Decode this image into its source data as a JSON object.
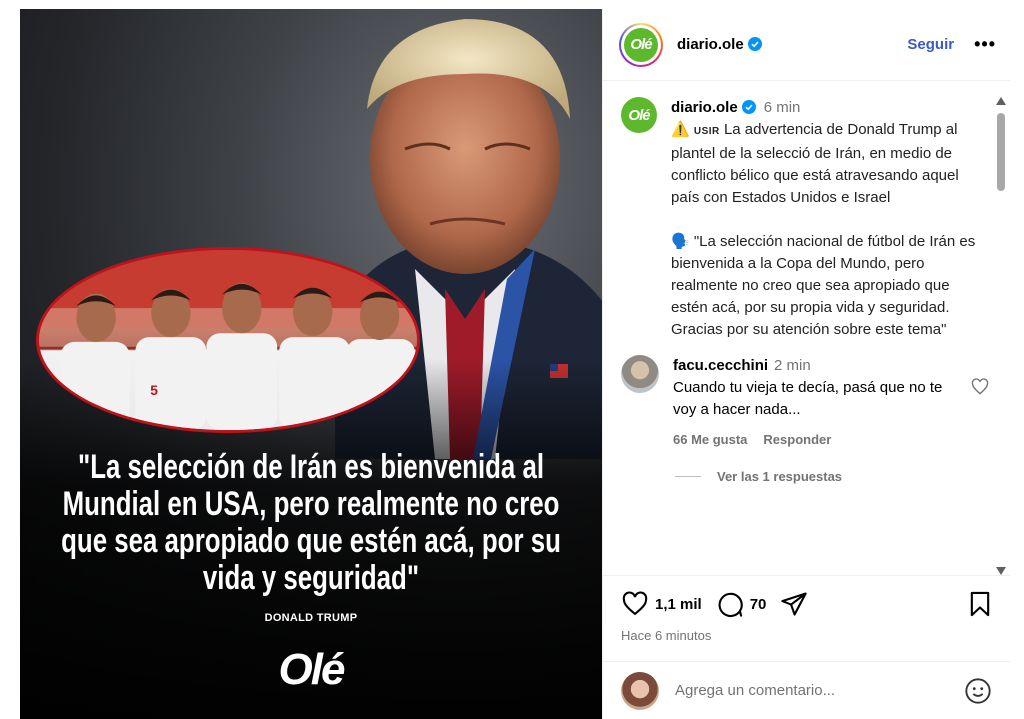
{
  "post": {
    "quote": "\"La selección de Irán es bienvenida al Mundial en USA, pero realmente no creo que sea apropiado que estén acá, por su vida y seguridad\"",
    "author": "DONALD TRUMP",
    "brand": "Olé"
  },
  "header": {
    "logo": "Olé",
    "username": "diario.ole",
    "follow_label": "Seguir",
    "more_label": "•••"
  },
  "caption": {
    "username": "diario.ole",
    "time": "6 min",
    "flag": "USIR",
    "text1": "La advertencia de Donald Trump al plantel de la selecció de Irán, en medio de conflicto bélico que está atravesando aquel país con Estados Unidos e Israel",
    "text2": "\"La selección nacional de fútbol de Irán es bienvenida a la Copa del Mundo, pero realmente no creo que sea apropiado que estén acá, por su propia vida y seguridad. Gracias por su atención sobre este tema\""
  },
  "comment": {
    "username": "facu.cecchini",
    "time": "2 min",
    "text": "Cuando tu vieja te decía, pasá que no te voy a hacer nada...",
    "likes": "66 Me gusta",
    "reply": "Responder",
    "view_replies": "Ver las 1 respuestas"
  },
  "actions": {
    "likes": "1,1 mil",
    "comments": "70",
    "time_ago": "Hace 6 minutos"
  },
  "add_comment": {
    "placeholder": "Agrega un comentario..."
  },
  "icons": [
    "verified-icon",
    "heart-icon",
    "comment-icon",
    "share-icon",
    "bookmark-icon",
    "emoji-icon",
    "warning-icon",
    "speaking-icon"
  ],
  "colors": {
    "verified": "#0095f6",
    "follow": "#3a5bc7",
    "ole_green": "#5db82e",
    "oval_border": "#c0121a"
  }
}
